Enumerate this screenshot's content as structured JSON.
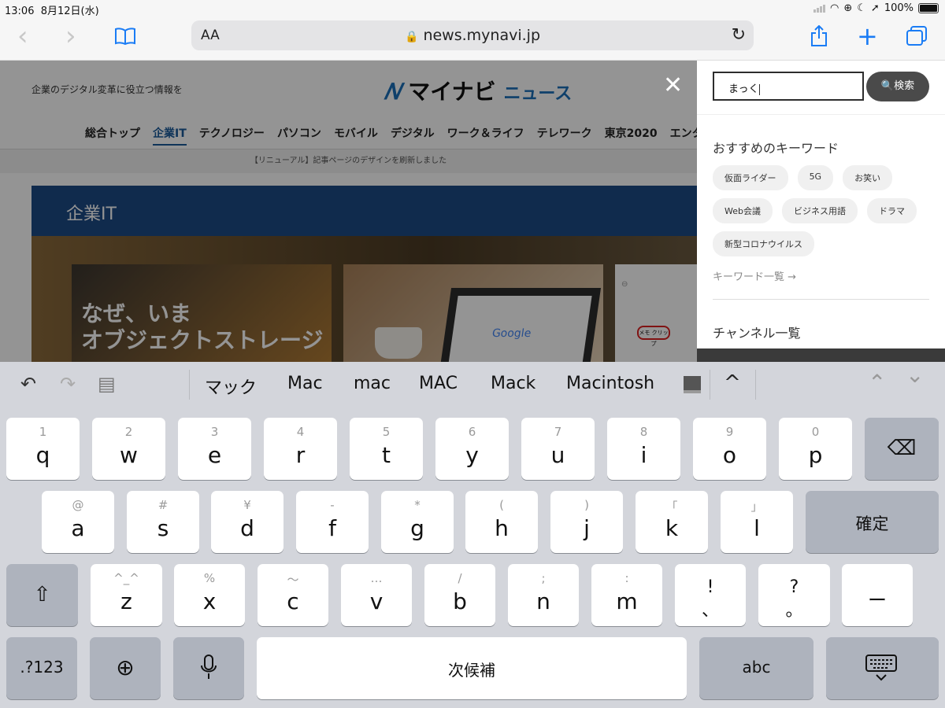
{
  "status": {
    "time": "13:06",
    "date": "8月12日(水)",
    "battery": "100%"
  },
  "toolbar": {
    "back": "‹",
    "forward": "›",
    "aa": "AA",
    "lock": "🔒",
    "url": "news.mynavi.jp",
    "reload": "↻",
    "share": "⇪",
    "newtab": "+"
  },
  "page": {
    "tagline": "企業のデジタル変革に役立つ情報を",
    "logo": "マイナビ",
    "logo_sub": "ニュース",
    "close": "✕",
    "nav": [
      "総合トップ",
      "企業IT",
      "テクノロジー",
      "パソコン",
      "モバイル",
      "デジタル",
      "ワーク＆ライフ",
      "テレワーク",
      "東京2020",
      "エンタメ"
    ],
    "notice": "【リニューアル】記事ページのデザインを刷新しました",
    "section": "企業IT",
    "card1": [
      "なぜ、いま",
      "オブジェクトストレージ"
    ],
    "card2_logo": "Google",
    "card3_label": "メモ クリップ"
  },
  "panel": {
    "search_value": "まっく",
    "search_button": "検索",
    "keywords_title": "おすすめのキーワード",
    "keywords": [
      "仮面ライダー",
      "5G",
      "お笑い",
      "Web会議",
      "ビジネス用語",
      "ドラマ",
      "新型コロナウイルス"
    ],
    "keywords_link": "キーワード一覧",
    "keywords_arrow": "→",
    "channels_title": "チャンネル一覧"
  },
  "keyboard": {
    "tools": {
      "undo": "↶",
      "redo": "↷",
      "paste": "▤"
    },
    "candidates": [
      "マック",
      "Mac",
      "mac",
      "MAC",
      "Mack",
      "Macintosh"
    ],
    "expand": "^",
    "nav_up": "⌃",
    "nav_down": "⌄",
    "row1": [
      [
        "1",
        "q"
      ],
      [
        "2",
        "w"
      ],
      [
        "3",
        "e"
      ],
      [
        "4",
        "r"
      ],
      [
        "5",
        "t"
      ],
      [
        "6",
        "y"
      ],
      [
        "7",
        "u"
      ],
      [
        "8",
        "i"
      ],
      [
        "9",
        "o"
      ],
      [
        "0",
        "p"
      ]
    ],
    "delete": "⌫",
    "row2": [
      [
        "@",
        "a"
      ],
      [
        "#",
        "s"
      ],
      [
        "¥",
        "d"
      ],
      [
        "-",
        "f"
      ],
      [
        "*",
        "g"
      ],
      [
        "(",
        "h"
      ],
      [
        ")",
        "j"
      ],
      [
        "「",
        "k"
      ],
      [
        "」",
        "l"
      ]
    ],
    "confirm": "確定",
    "shift": "⇧",
    "row3": [
      [
        "^_^",
        "z"
      ],
      [
        "%",
        "x"
      ],
      [
        "〜",
        "c"
      ],
      [
        "…",
        "v"
      ],
      [
        "/",
        "b"
      ],
      [
        ";",
        "n"
      ],
      [
        ":",
        "m"
      ],
      [
        "!",
        "、"
      ],
      [
        "?",
        "。"
      ]
    ],
    "dash": "ー",
    "numbers": ".?123",
    "globe": "⊕",
    "mic": "🎤",
    "space": "次候補",
    "abc": "abc",
    "hide": "⌨"
  }
}
